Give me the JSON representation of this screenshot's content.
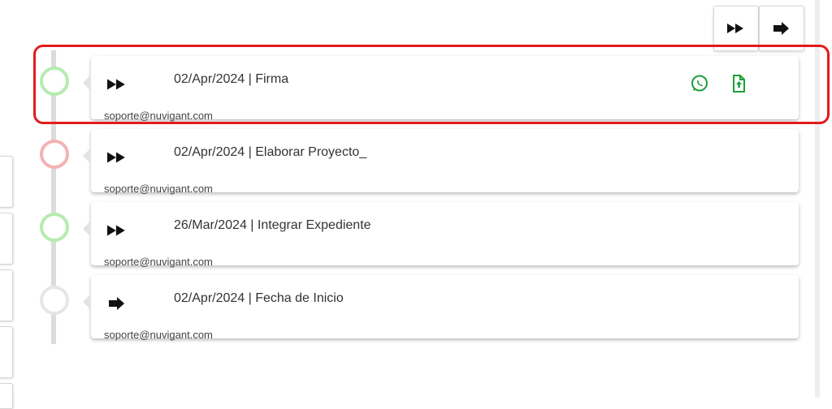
{
  "colors": {
    "accent_green": "#1e9e3a",
    "highlight_red": "#e31b1b",
    "status_green": "#b6ebb0",
    "status_red": "#f4b3b3",
    "status_grey": "#e6e6e6"
  },
  "toolbar": {
    "buttons": [
      {
        "icon": "fast-forward-icon"
      },
      {
        "icon": "arrow-right-icon"
      }
    ]
  },
  "timeline": {
    "items": [
      {
        "date_title": "02/Apr/2024 | Firma",
        "email": "soporte@nuvigant.com",
        "status": "green",
        "icon": "fast-forward-icon",
        "actions": [
          "whatsapp-icon",
          "file-upload-icon"
        ],
        "highlighted": true
      },
      {
        "date_title": "02/Apr/2024 | Elaborar Proyecto_",
        "email": "soporte@nuvigant.com",
        "status": "red",
        "icon": "fast-forward-icon"
      },
      {
        "date_title": "26/Mar/2024 | Integrar Expediente",
        "email": "soporte@nuvigant.com",
        "status": "green",
        "icon": "fast-forward-icon"
      },
      {
        "date_title": "02/Apr/2024 | Fecha de Inicio",
        "email": "soporte@nuvigant.com",
        "status": "grey",
        "icon": "arrow-right-icon"
      }
    ]
  }
}
